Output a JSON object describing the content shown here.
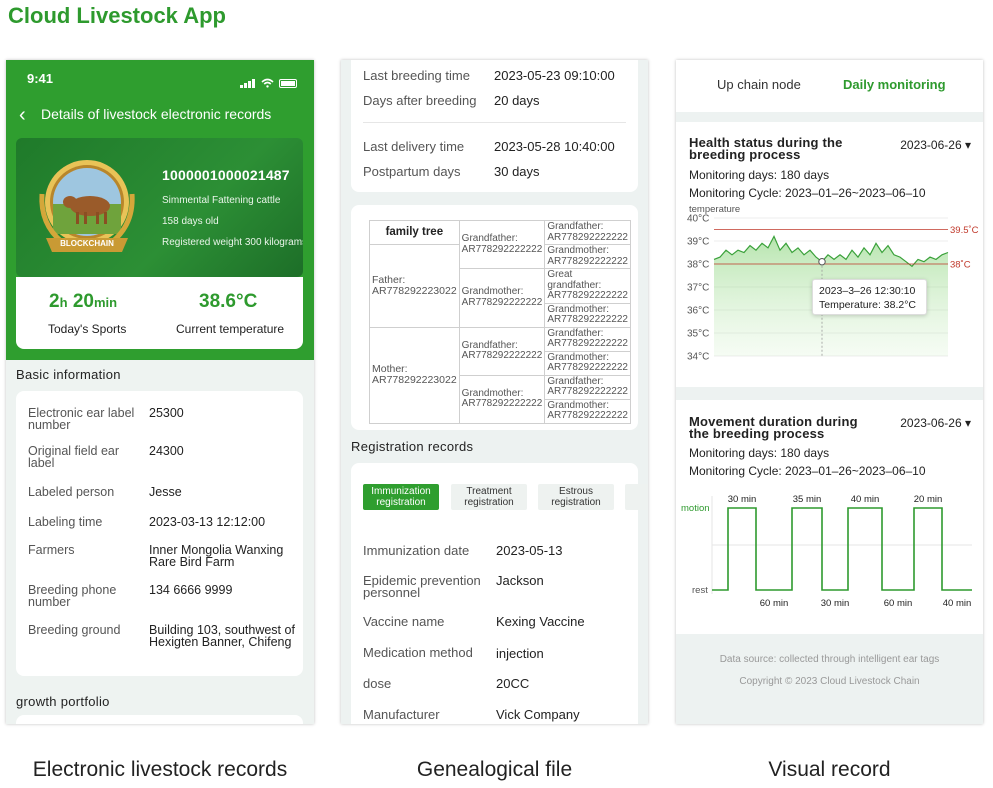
{
  "app_title": "Cloud Livestock App",
  "captions": {
    "records": "Electronic livestock records",
    "genealogy": "Genealogical file",
    "visual": "Visual record"
  },
  "colors": {
    "brand_green": "#2e9a2e",
    "header_green": "#2f9e2f",
    "threshold_red": "#c0392b"
  },
  "screen1": {
    "status_time": "9:41",
    "nav_title": "Details of livestock electronic records",
    "badge_text": "BLOCKCHAIN",
    "cattle": {
      "id": "1000001000021487",
      "breed": "Simmental Fattening cattle",
      "age": "158 days old",
      "weight": "Registered weight 300 kilograms"
    },
    "sports": {
      "hours": "2",
      "h_unit": "h",
      "minutes": "20",
      "min_unit": "min",
      "label": "Today's Sports"
    },
    "temperature": {
      "value": "38.6°C",
      "label": "Current temperature"
    },
    "basic_title": "Basic information",
    "basic_rows": [
      {
        "label": "Electronic ear label number",
        "value": "25300"
      },
      {
        "label": "Original field ear label",
        "value": "24300"
      },
      {
        "label": "Labeled person",
        "value": "Jesse"
      },
      {
        "label": "Labeling time",
        "value": "2023-03-13 12:12:00"
      },
      {
        "label": "Farmers",
        "value": "Inner Mongolia Wanxing Rare Bird Farm"
      },
      {
        "label": "Breeding phone number",
        "value": "134 6666 9999"
      },
      {
        "label": "Breeding ground",
        "value": "Building 103, southwest of Hexigten Banner, Chifeng"
      }
    ],
    "growth_title": "growth portfolio"
  },
  "screen2": {
    "breeding": [
      {
        "label": "Last breeding time",
        "value": "2023-05-23  09:10:00"
      },
      {
        "label": "Days after breeding",
        "value": "20 days"
      }
    ],
    "delivery": [
      {
        "label": "Last delivery time",
        "value": "2023-05-28  10:40:00"
      },
      {
        "label": "Postpartum days",
        "value": "30 days"
      }
    ],
    "family_tree": {
      "title": "family tree",
      "father": "Father: AR778292223022",
      "mother": "Mother: AR778292223022",
      "gp1": "Grandfather: AR778292222222",
      "gm1": "Grandmother: AR778292222222",
      "gp2": "Grandfather: AR778292222222",
      "gm2": "Grandmother: AR778292222222",
      "ggf": "Grandfather: AR778292222222",
      "ggm": "Grandmother: AR778292222222",
      "great_gf": "Great grandfather: AR778292222222",
      "ggm2": "Grandmother: AR778292222222",
      "ggf3": "Grandfather: AR778292222222",
      "ggm3": "Grandmother: AR778292222222",
      "ggf4": "Grandfather: AR778292222222",
      "ggm4": "Grandmother: AR778292222222"
    },
    "registration_title": "Registration records",
    "reg_tabs": [
      "Immunization registration",
      "Treatment registration",
      "Estrous registration"
    ],
    "reg_rows": [
      {
        "label": "Immunization date",
        "value": "2023-05-13"
      },
      {
        "label": "Epidemic prevention personnel",
        "value": "Jackson"
      },
      {
        "label": "Vaccine name",
        "value": "Kexing Vaccine"
      },
      {
        "label": "Medication method",
        "value": "injection"
      },
      {
        "label": "dose",
        "value": "20CC"
      },
      {
        "label": "Manufacturer",
        "value": "Vick Company"
      }
    ]
  },
  "screen3": {
    "tabs": [
      "Up chain node",
      "Daily monitoring"
    ],
    "health": {
      "title": "Health status during the breeding process",
      "date": "2023-06-26",
      "monitoring_days": "Monitoring days: 180 days",
      "monitoring_cycle": "Monitoring Cycle:  2023–01–26~2023–06–10",
      "tooltip_date": "2023–3–26  12:30:10",
      "tooltip_temp": "Temperature:  38.2°C"
    },
    "movement": {
      "title": "Movement duration during the breeding process",
      "date": "2023-06-26",
      "monitoring_days": "Monitoring days: 180 days",
      "monitoring_cycle": "Monitoring Cycle:  2023–01–26~2023–06–10"
    },
    "footer_source": "Data source: collected through intelligent ear tags",
    "footer_copyright": "Copyright ©  2023 Cloud Livestock Chain"
  },
  "chart_data": [
    {
      "type": "area",
      "ylabel": "temperature",
      "ylim": [
        34,
        40
      ],
      "yticks": [
        "40°C",
        "39°C",
        "38°C",
        "37°C",
        "36°C",
        "35°C",
        "34°C"
      ],
      "threshold_lines": [
        {
          "value": 39.5,
          "label": "39.5˚C",
          "color": "#c0392b"
        },
        {
          "value": 38.0,
          "label": "38˚C",
          "color": "#c0392b"
        }
      ],
      "series": [
        {
          "values": [
            38.2,
            38.3,
            38.6,
            38.4,
            38.6,
            38.5,
            38.8,
            38.6,
            38.9,
            38.7,
            39.2,
            38.6,
            38.9,
            38.5,
            38.7,
            38.4,
            38.6,
            38.3,
            38.1,
            38.4,
            38.2,
            38.4,
            38.2,
            38.6,
            38.3,
            38.7,
            38.4,
            38.9,
            38.5,
            38.8,
            38.4,
            38.3,
            38.1,
            37.9,
            38.2,
            38.1,
            38.3,
            38.2,
            38.4,
            38.5
          ]
        }
      ],
      "highlight_index": 18
    },
    {
      "type": "line",
      "ylabels": [
        "motion",
        "rest"
      ],
      "series": [
        {
          "values": [
            0,
            1,
            0,
            1,
            0,
            1,
            0,
            1,
            0
          ]
        }
      ],
      "top_labels": [
        "30 min",
        "35 min",
        "40 min",
        "20 min"
      ],
      "bottom_labels": [
        "60 min",
        "30 min",
        "60 min",
        "40 min"
      ]
    }
  ]
}
